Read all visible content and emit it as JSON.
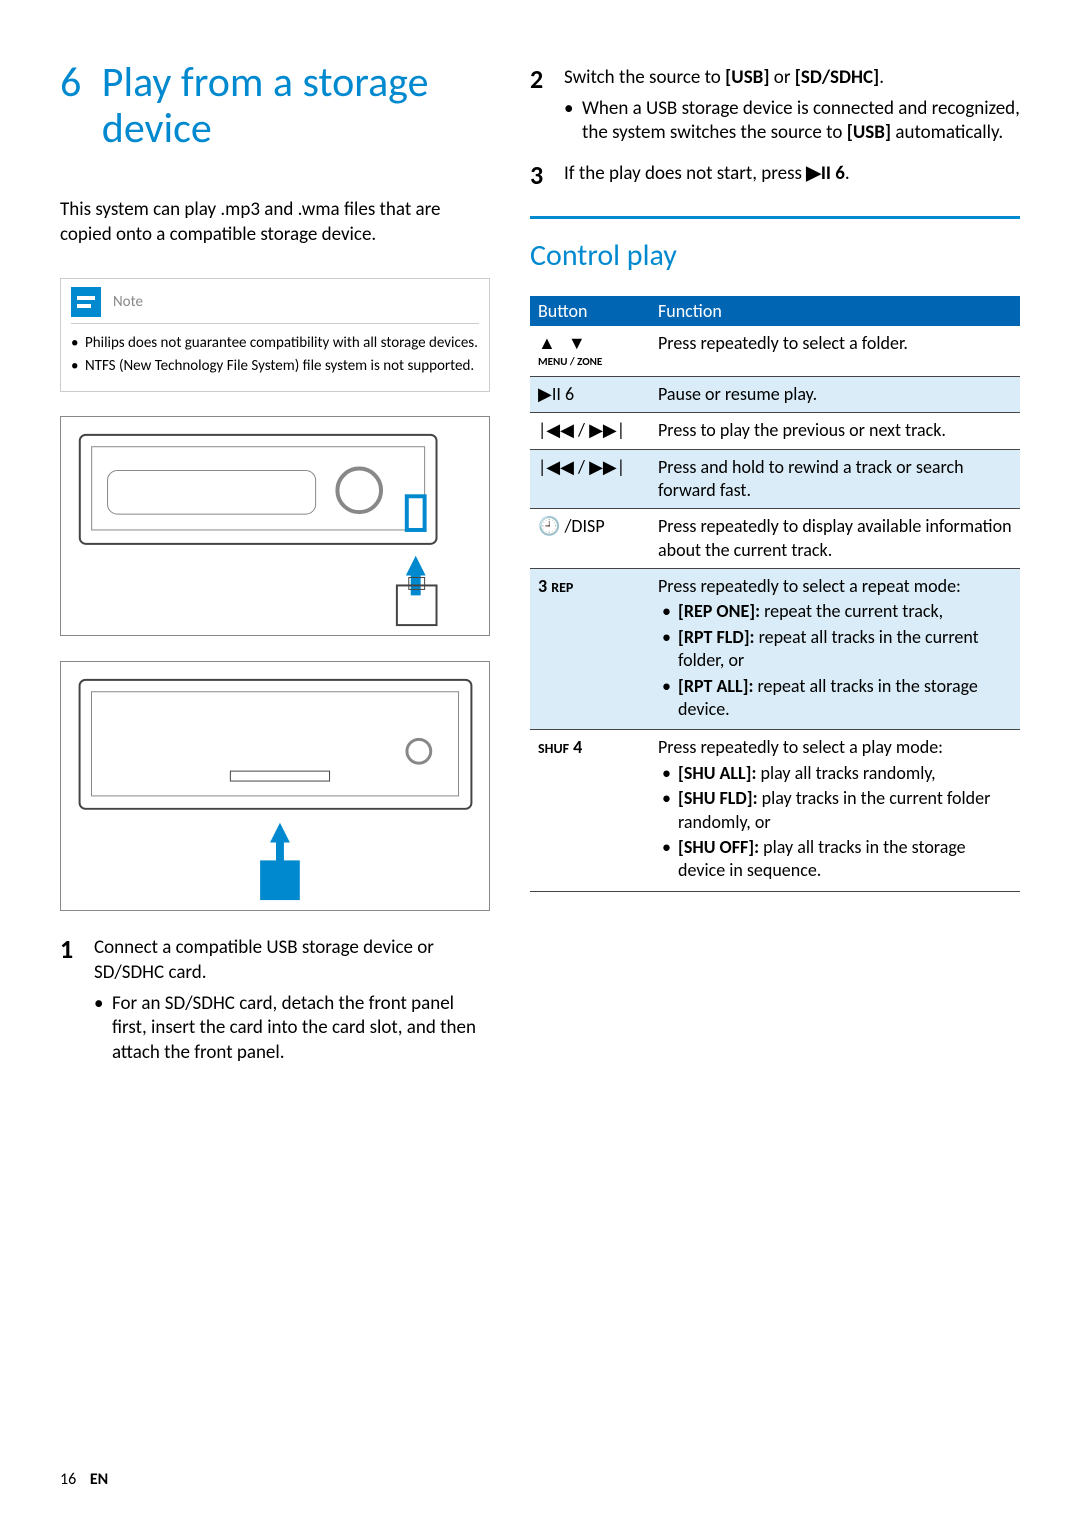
{
  "section": {
    "number": "6",
    "title": "Play from a storage device"
  },
  "intro": "This system can play .mp3 and .wma files that are copied onto a compatible storage device.",
  "note": {
    "label": "Note",
    "items": [
      "Philips does not guarantee compatibility with all storage devices.",
      "NTFS (New Technology File System) file system is not supported."
    ]
  },
  "steps_left": {
    "s1": {
      "num": "1",
      "text": "Connect a compatible USB storage device or SD/SDHC card.",
      "sub1": "For an SD/SDHC card, detach the front panel first, insert the card into the card slot, and then attach the front panel."
    }
  },
  "steps_right": {
    "s2": {
      "num": "2",
      "text_a": "Switch the source to ",
      "usb": "[USB]",
      "text_b": " or ",
      "sd": "[SD/SDHC]",
      "text_c": ".",
      "sub1_a": "When a USB storage device is connected and recognized, the system switches the source to ",
      "sub1_b": "[USB]",
      "sub1_c": " automatically."
    },
    "s3": {
      "num": "3",
      "text_a": "If the play does not start, press ",
      "icon": "▶II 6",
      "text_b": "."
    }
  },
  "subheading": "Control play",
  "table": {
    "headers": {
      "button": "Button",
      "function": "Function"
    },
    "rows": {
      "r1": {
        "btn_top": "▲    ▼",
        "btn_bottom": "MENU / ZONE",
        "func": "Press repeatedly to select a folder."
      },
      "r2": {
        "btn": "▶II 6",
        "func": "Pause or resume play."
      },
      "r3": {
        "btn": "|◀◀ / ▶▶|",
        "func": "Press to play the previous or next track."
      },
      "r4": {
        "btn": "|◀◀ / ▶▶|",
        "func": "Press and hold to rewind a track or search forward fast."
      },
      "r5": {
        "btn": "🕘 /DISP",
        "func": "Press repeatedly to display available information about the current track."
      },
      "r6": {
        "btn": "3 REP",
        "func_lead": "Press repeatedly to select a repeat mode:",
        "i1_b": "[REP ONE]:",
        "i1_t": " repeat the current track,",
        "i2_b": "[RPT FLD]:",
        "i2_t": " repeat all tracks in the current folder, or",
        "i3_b": "[RPT ALL]:",
        "i3_t": " repeat all tracks in the storage device."
      },
      "r7": {
        "btn": "SHUF 4",
        "func_lead": "Press repeatedly to select a play mode:",
        "i1_b": "[SHU ALL]:",
        "i1_t": " play all tracks randomly,",
        "i2_b": "[SHU FLD]:",
        "i2_t": " play tracks in the current folder randomly, or",
        "i3_b": "[SHU OFF]:",
        "i3_t": " play all tracks in the storage device in sequence."
      }
    }
  },
  "footer": {
    "page": "16",
    "lang": "EN"
  }
}
